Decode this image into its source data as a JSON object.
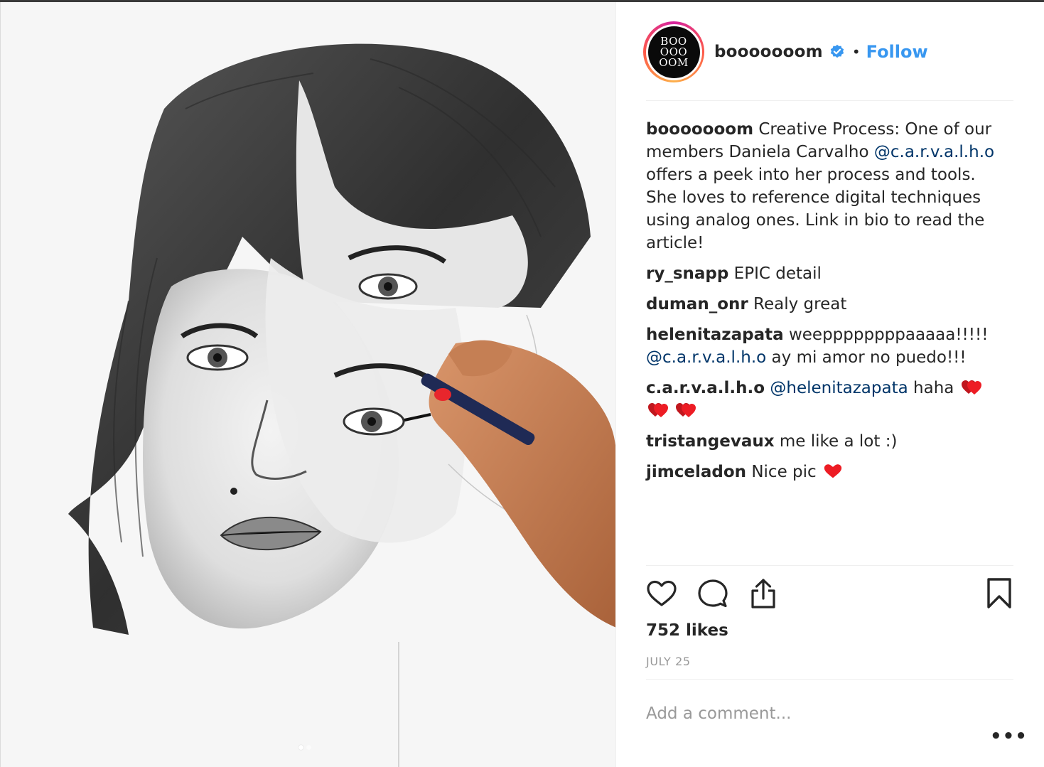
{
  "post": {
    "author": "booooooom",
    "avatar_lines": [
      "BOO",
      "OOO",
      "OOM"
    ],
    "separator": "•",
    "follow_label": "Follow",
    "likes": "752 likes",
    "date": "JULY 25",
    "comment_placeholder": "Add a comment...",
    "more_label": "•••",
    "image_dots": 2,
    "active_dot": 0
  },
  "caption": {
    "user": "booooooom",
    "text1": "Creative Process: One of our members Daniela Carvalho",
    "mention": "@c.a.r.v.a.l.h.o",
    "text2": "offers a peek into her process and tools. She loves to reference digital techniques using analog ones. Link in bio to read the article!"
  },
  "comments": [
    {
      "user": "ry_snapp",
      "text": "EPIC detail"
    },
    {
      "user": "duman_onr",
      "text": "Realy great"
    },
    {
      "user": "helenitazapata",
      "text": "weeppppppppaaaaa!!!!!",
      "mention": "@c.a.r.v.a.l.h.o",
      "text_after": "ay mi amor no puedo!!!"
    },
    {
      "user": "c.a.r.v.a.l.h.o",
      "mention": "@helenitazapata",
      "text": "haha",
      "emoji": "heart-pair-icon",
      "emoji_count": 3
    },
    {
      "user": "tristangevaux",
      "text": "me like a lot :)"
    },
    {
      "user": "jimceladon",
      "text": "Nice pic",
      "emoji": "heart-icon",
      "emoji_count": 1
    }
  ],
  "icons": {
    "like": "heart-outline-icon",
    "comment": "speech-bubble-icon",
    "share": "share-upload-icon",
    "save": "bookmark-icon",
    "verified": "verified-badge-icon"
  },
  "colors": {
    "link": "#3897f0",
    "mention": "#003569",
    "muted": "#999999",
    "heart": "#ed1c24"
  }
}
